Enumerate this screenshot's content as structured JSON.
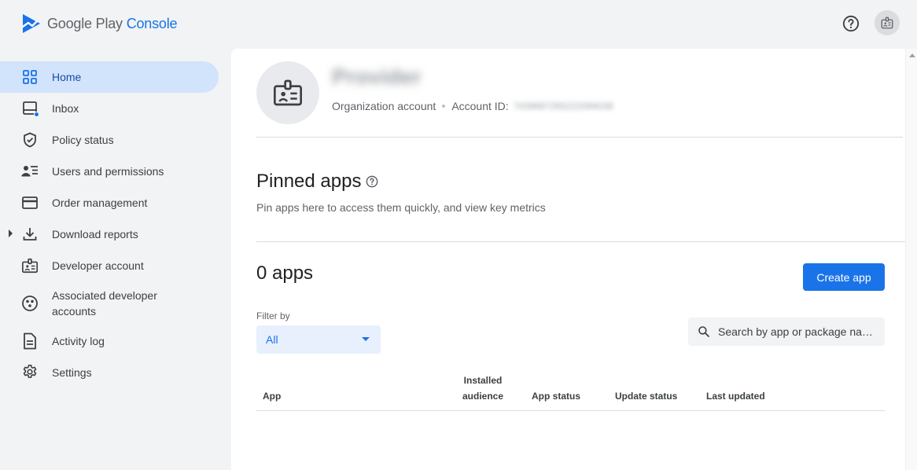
{
  "header": {
    "app_name_prefix": "Google Play",
    "app_name_suffix": "Console",
    "help_icon": "help-circle-icon",
    "account_icon": "badge-icon"
  },
  "sidebar": {
    "items": [
      {
        "label": "Home",
        "icon": "grid-icon",
        "active": true
      },
      {
        "label": "Inbox",
        "icon": "inbox-icon"
      },
      {
        "label": "Policy status",
        "icon": "shield-icon"
      },
      {
        "label": "Users and permissions",
        "icon": "users-icon"
      },
      {
        "label": "Order management",
        "icon": "credit-card-icon"
      },
      {
        "label": "Download reports",
        "icon": "download-icon"
      },
      {
        "label": "Developer account",
        "icon": "badge-icon"
      },
      {
        "label": "Associated developer accounts",
        "icon": "linked-accounts-icon"
      },
      {
        "label": "Activity log",
        "icon": "document-icon"
      },
      {
        "label": "Settings",
        "icon": "gear-icon"
      }
    ]
  },
  "account": {
    "name": "Provider",
    "type": "Organization account",
    "id_label": "Account ID:",
    "id_value": "7439687265222094038"
  },
  "pinned": {
    "title": "Pinned apps",
    "subtitle": "Pin apps here to access them quickly, and view key metrics"
  },
  "apps": {
    "count_label": "0 apps",
    "create_button": "Create app",
    "filter_label": "Filter by",
    "filter_value": "All",
    "search_placeholder": "Search by app or package name",
    "columns": {
      "app": "App",
      "installed_1": "Installed",
      "installed_2": "audience",
      "app_status": "App status",
      "update_status": "Update status",
      "last_updated": "Last updated"
    }
  },
  "colors": {
    "accent": "#1a73e8",
    "active_nav_bg": "#d2e3fc",
    "page_bg": "#f1f3f4"
  }
}
